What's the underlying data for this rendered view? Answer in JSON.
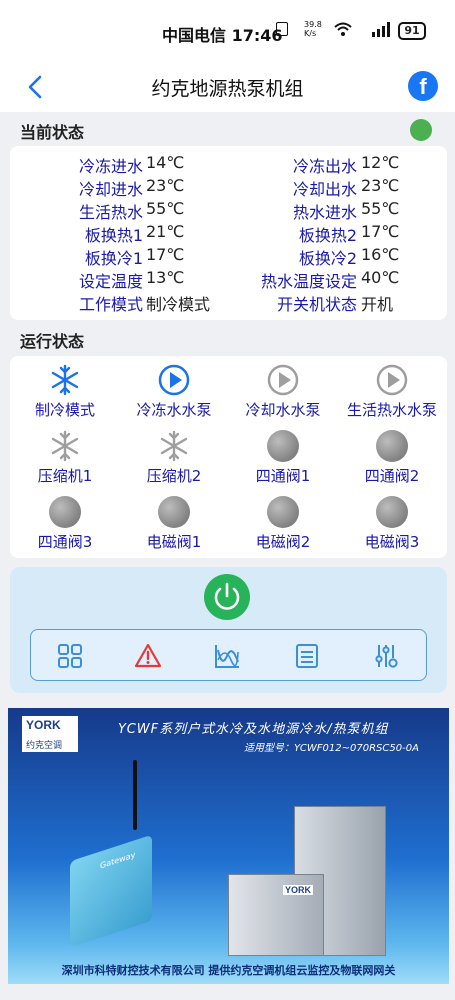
{
  "status_bar": {
    "carrier_time": "中国电信 17:46",
    "net_speed": "39.8 K/s",
    "battery": "91"
  },
  "header": {
    "title": "约克地源热泵机组",
    "facebook_label": "f"
  },
  "current_status": {
    "title": "当前状态",
    "online_color": "#4caf50",
    "rows": [
      {
        "l1": "冷冻进水",
        "v1": "14℃",
        "l2": "冷冻出水",
        "v2": "12℃"
      },
      {
        "l1": "冷却进水",
        "v1": "23℃",
        "l2": "冷却出水",
        "v2": "23℃"
      },
      {
        "l1": "生活热水",
        "v1": "55℃",
        "l2": "热水进水",
        "v2": "55℃"
      },
      {
        "l1": "板换热1",
        "v1": "21℃",
        "l2": "板换热2",
        "v2": "17℃"
      },
      {
        "l1": "板换冷1",
        "v1": "17℃",
        "l2": "板换冷2",
        "v2": "16℃"
      },
      {
        "l1": "设定温度",
        "v1": "13℃",
        "l2": "热水温度设定",
        "v2": "40℃"
      },
      {
        "l1": "工作模式",
        "v1": "制冷模式",
        "l2": "开关机状态",
        "v2": "开机"
      }
    ]
  },
  "run_status": {
    "title": "运行状态",
    "tiles": [
      {
        "label": "制冷模式",
        "icon": "snowflake-icon",
        "state": "active"
      },
      {
        "label": "冷冻水水泵",
        "icon": "play-circle-icon",
        "state": "active"
      },
      {
        "label": "冷却水水泵",
        "icon": "play-circle-icon",
        "state": "inactive"
      },
      {
        "label": "生活热水水泵",
        "icon": "play-circle-icon",
        "state": "inactive"
      },
      {
        "label": "压缩机1",
        "icon": "snowflake-icon",
        "state": "inactive"
      },
      {
        "label": "压缩机2",
        "icon": "snowflake-icon",
        "state": "inactive"
      },
      {
        "label": "四通阀1",
        "icon": "gray-ball-icon",
        "state": "inactive"
      },
      {
        "label": "四通阀2",
        "icon": "gray-ball-icon",
        "state": "inactive"
      },
      {
        "label": "四通阀3",
        "icon": "gray-ball-icon",
        "state": "inactive"
      },
      {
        "label": "电磁阀1",
        "icon": "gray-ball-icon",
        "state": "inactive"
      },
      {
        "label": "电磁阀2",
        "icon": "gray-ball-icon",
        "state": "inactive"
      },
      {
        "label": "电磁阀3",
        "icon": "gray-ball-icon",
        "state": "inactive"
      }
    ]
  },
  "controls": {
    "power_icon": "power-icon",
    "power_color": "#27b35a",
    "toolbar": [
      "grid-icon",
      "warning-icon",
      "chart-icon",
      "list-icon",
      "sliders-icon"
    ]
  },
  "banner": {
    "logo_brand": "YORK",
    "logo_cn": "约克空调",
    "title": "YCWF系列户式水冷及水地源冷水/热泵机组",
    "model": "适用型号：YCWF012~070RSC50-0A",
    "gateway_text": "Gateway",
    "unit_label": "YORK",
    "footer": "深圳市科特财控技术有限公司    提供约克空调机组云监控及物联网网关"
  }
}
